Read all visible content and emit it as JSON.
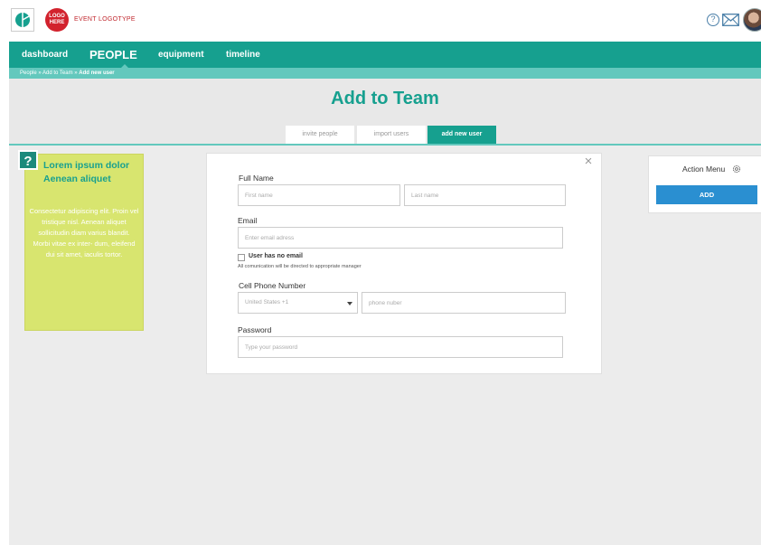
{
  "header": {
    "logo_badge": "LOGO HERE",
    "brand_text": "EVENT LOGOTYPE"
  },
  "nav": {
    "items": [
      {
        "label": "dashboard"
      },
      {
        "label": "PEOPLE"
      },
      {
        "label": "equipment"
      },
      {
        "label": "timeline"
      }
    ],
    "active": "PEOPLE"
  },
  "breadcrumb": {
    "people": "People",
    "add_to_team": "Add to Team",
    "current": "Add new user",
    "separator": " » "
  },
  "page": {
    "title": "Add to Team",
    "tabs": [
      {
        "label": "invite people"
      },
      {
        "label": "import users"
      },
      {
        "label": "add new user"
      }
    ],
    "active_tab": "add new user"
  },
  "help_note": {
    "badge": "?",
    "title": "Lorem ipsum dolor Aenean aliquet",
    "body": "Consectetur adipiscing elit. Proin vel tristique nisl. Aenean aliquet sollicitudin diam varius blandit. Morbi vitae ex inter- dum, eleifend dui sit amet, iaculis tortor."
  },
  "form": {
    "close": "×",
    "full_name_label": "Full Name",
    "first_name_placeholder": "First name",
    "last_name_placeholder": "Last name",
    "email_label": "Email",
    "email_placeholder": "Enter email adress",
    "no_email_label": "User has no email",
    "no_email_note": "All comunication will be directed to appropriate manager",
    "phone_label": "Cell Phone Number",
    "country_selected": "United States +1",
    "phone_placeholder": "phone nuber",
    "password_label": "Password",
    "password_placeholder": "Type your password"
  },
  "action_menu": {
    "title": "Action Menu",
    "add_label": "ADD"
  },
  "colors": {
    "teal": "#16a08f",
    "light_teal": "#63c8bd",
    "note_yellow": "#d8e56f",
    "button_blue": "#2a8fd1",
    "logo_red": "#d2222d"
  }
}
